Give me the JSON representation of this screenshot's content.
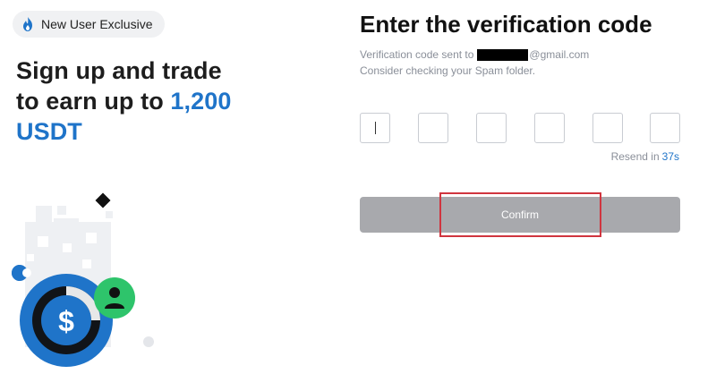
{
  "promo": {
    "badge_label": "New User Exclusive",
    "headline_line1": "Sign up and trade",
    "headline_line2_prefix": "to earn up to ",
    "headline_amount": "1,200",
    "headline_currency": "USDT",
    "accent_color": "#1f74c9",
    "illustration_symbol": "$"
  },
  "verification": {
    "title": "Enter the verification code",
    "sent_prefix": "Verification code sent to",
    "email_domain": "@gmail.com",
    "spam_hint": "Consider checking your Spam folder.",
    "code_digits": [
      "",
      "",
      "",
      "",
      "",
      ""
    ],
    "resend_label": "Resend in",
    "resend_countdown": "37s",
    "confirm_label": "Confirm"
  },
  "colors": {
    "confirm_bg": "#a8a9ad",
    "highlight_border": "#d0353f",
    "brand_blue": "#1f74c9",
    "avatar_green": "#2ec46b"
  }
}
